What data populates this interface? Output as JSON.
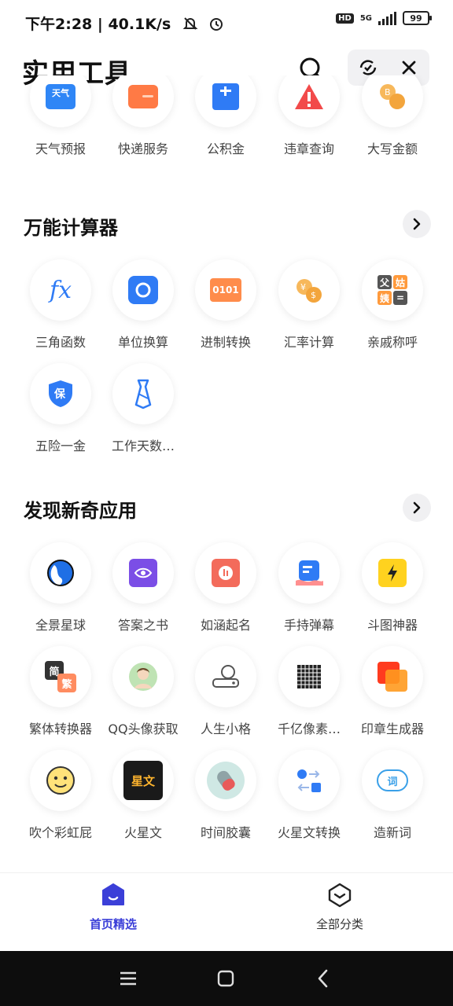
{
  "status": {
    "time": "下午2:28",
    "speed": "40.1K/s",
    "hd": "HD",
    "network": "5G",
    "battery": "99"
  },
  "header": {
    "title": "实用工具"
  },
  "top_tools": [
    {
      "label": "天气预报",
      "icon": "weather-icon",
      "badge": "天气"
    },
    {
      "label": "快递服务",
      "icon": "delivery-icon"
    },
    {
      "label": "公积金",
      "icon": "housing-fund-icon"
    },
    {
      "label": "违章查询",
      "icon": "violation-icon"
    },
    {
      "label": "大写金额",
      "icon": "money-icon"
    }
  ],
  "section_calc": {
    "title": "万能计算器",
    "tools": [
      {
        "label": "三角函数",
        "icon": "fx-icon",
        "glyph": "fx"
      },
      {
        "label": "单位换算",
        "icon": "unit-convert-icon"
      },
      {
        "label": "进制转换",
        "icon": "base-convert-icon",
        "glyph": "0101"
      },
      {
        "label": "汇率计算",
        "icon": "exchange-rate-icon"
      },
      {
        "label": "亲戚称呼",
        "icon": "relatives-icon",
        "glyph": [
          "父",
          "姑",
          "姨",
          "="
        ]
      },
      {
        "label": "五险一金",
        "icon": "insurance-icon",
        "glyph": "保"
      },
      {
        "label": "工作天数…",
        "icon": "workday-icon"
      }
    ]
  },
  "section_apps": {
    "title": "发现新奇应用",
    "tools": [
      {
        "label": "全景星球",
        "icon": "planet-icon"
      },
      {
        "label": "答案之书",
        "icon": "answer-book-icon"
      },
      {
        "label": "如涵起名",
        "icon": "naming-icon"
      },
      {
        "label": "手持弹幕",
        "icon": "barrage-icon"
      },
      {
        "label": "斗图神器",
        "icon": "meme-icon"
      },
      {
        "label": "繁体转换器",
        "icon": "traditional-icon",
        "glyph": [
          "简",
          "繁"
        ]
      },
      {
        "label": "QQ头像获取",
        "icon": "avatar-icon"
      },
      {
        "label": "人生小格",
        "icon": "life-grid-icon"
      },
      {
        "label": "千亿像素…",
        "icon": "pixel-icon"
      },
      {
        "label": "印章生成器",
        "icon": "seal-icon"
      },
      {
        "label": "吹个彩虹屁",
        "icon": "smile-icon"
      },
      {
        "label": "火星文",
        "icon": "mars-text-icon",
        "glyph": "星文"
      },
      {
        "label": "时间胶囊",
        "icon": "time-capsule-icon"
      },
      {
        "label": "火星文转换",
        "icon": "mars-convert-icon"
      },
      {
        "label": "造新词",
        "icon": "new-word-icon",
        "glyph": "词"
      }
    ]
  },
  "bottom_nav": [
    {
      "label": "首页精选",
      "icon": "home-icon",
      "active": true
    },
    {
      "label": "全部分类",
      "icon": "category-icon",
      "active": false
    }
  ],
  "colors": {
    "accent": "#3b3fd8",
    "blue": "#2f7bf5",
    "orange": "#ff7a45"
  }
}
